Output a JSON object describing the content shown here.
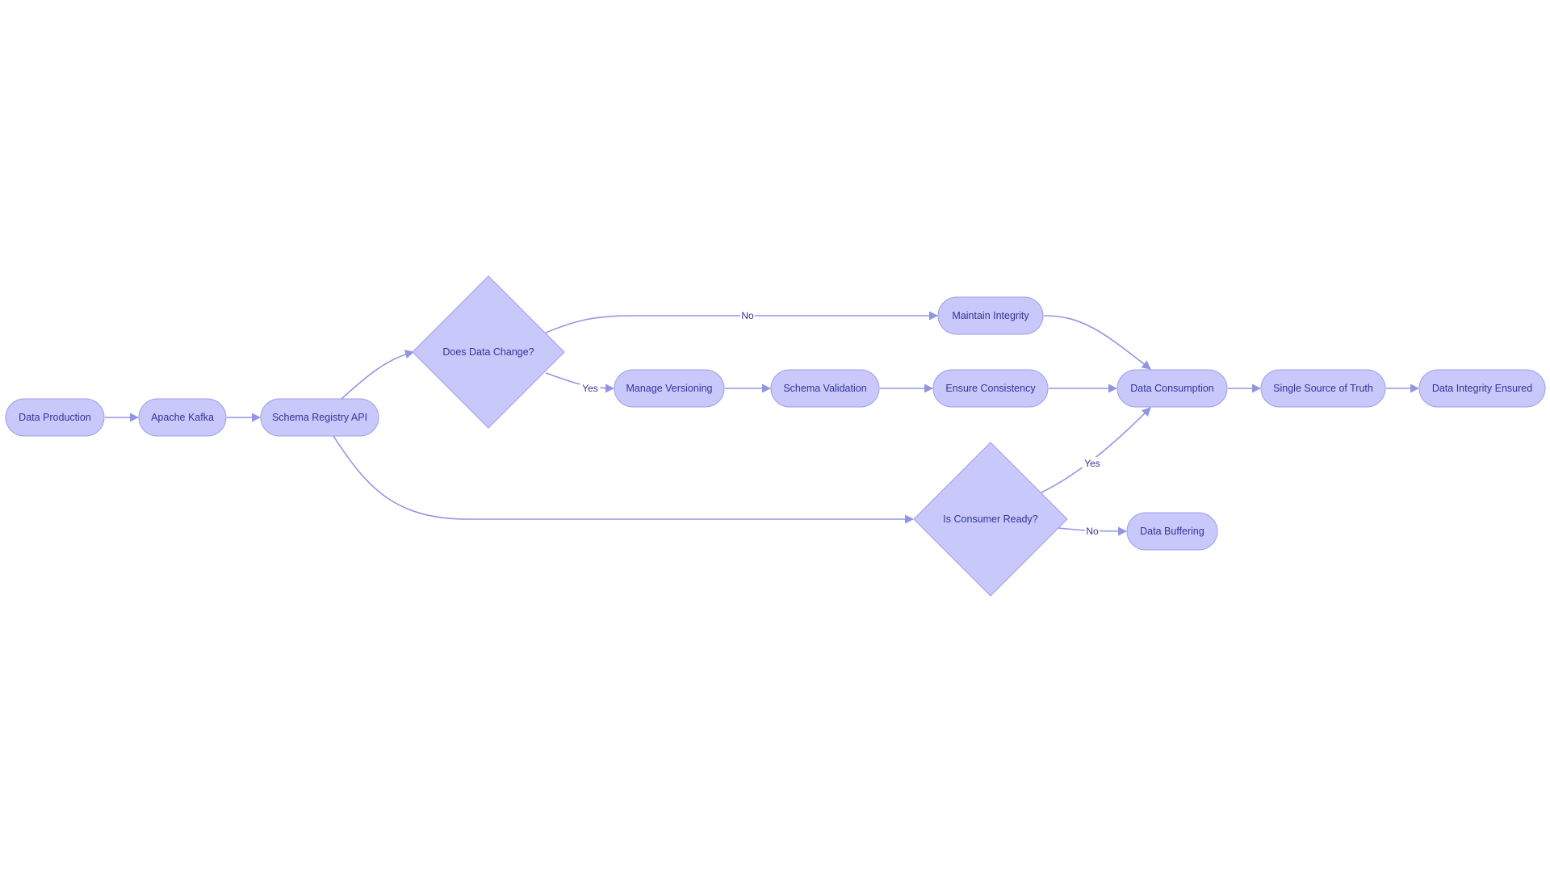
{
  "diagram": {
    "type": "flowchart",
    "direction": "left-to-right",
    "colors": {
      "node_fill": "#c8c9fa",
      "node_stroke": "#9c9ee8",
      "edge": "#9395e3",
      "text": "#333399",
      "background": "#ffffff"
    },
    "nodes": [
      {
        "id": "A",
        "label": "Data Production",
        "shape": "stadium"
      },
      {
        "id": "B",
        "label": "Apache Kafka",
        "shape": "stadium"
      },
      {
        "id": "C",
        "label": "Schema Registry API",
        "shape": "stadium"
      },
      {
        "id": "D",
        "label": "Does Data Change?",
        "shape": "diamond"
      },
      {
        "id": "E",
        "label": "Manage Versioning",
        "shape": "stadium"
      },
      {
        "id": "F",
        "label": "Schema Validation",
        "shape": "stadium"
      },
      {
        "id": "G",
        "label": "Ensure Consistency",
        "shape": "stadium"
      },
      {
        "id": "H",
        "label": "Maintain Integrity",
        "shape": "stadium"
      },
      {
        "id": "I",
        "label": "Data Consumption",
        "shape": "stadium"
      },
      {
        "id": "J",
        "label": "Single Source of Truth",
        "shape": "stadium"
      },
      {
        "id": "K",
        "label": "Data Integrity Ensured",
        "shape": "stadium"
      },
      {
        "id": "L",
        "label": "Is Consumer Ready?",
        "shape": "diamond"
      },
      {
        "id": "M",
        "label": "Data Buffering",
        "shape": "stadium"
      }
    ],
    "edges": [
      {
        "from": "A",
        "to": "B",
        "label": ""
      },
      {
        "from": "B",
        "to": "C",
        "label": ""
      },
      {
        "from": "C",
        "to": "D",
        "label": ""
      },
      {
        "from": "D",
        "to": "E",
        "label": "Yes"
      },
      {
        "from": "E",
        "to": "F",
        "label": ""
      },
      {
        "from": "F",
        "to": "G",
        "label": ""
      },
      {
        "from": "G",
        "to": "I",
        "label": ""
      },
      {
        "from": "D",
        "to": "H",
        "label": "No"
      },
      {
        "from": "H",
        "to": "I",
        "label": ""
      },
      {
        "from": "I",
        "to": "J",
        "label": ""
      },
      {
        "from": "J",
        "to": "K",
        "label": ""
      },
      {
        "from": "C",
        "to": "L",
        "label": ""
      },
      {
        "from": "L",
        "to": "I",
        "label": "Yes"
      },
      {
        "from": "L",
        "to": "M",
        "label": "No"
      }
    ]
  }
}
